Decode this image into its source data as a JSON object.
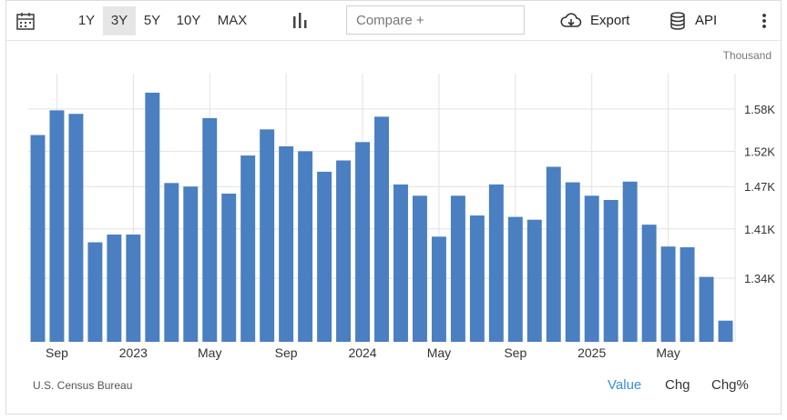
{
  "toolbar": {
    "ranges": [
      {
        "label": "1Y",
        "active": false
      },
      {
        "label": "3Y",
        "active": true
      },
      {
        "label": "5Y",
        "active": false
      },
      {
        "label": "10Y",
        "active": false
      },
      {
        "label": "MAX",
        "active": false
      }
    ],
    "compare_placeholder": "Compare +",
    "export_label": "Export",
    "api_label": "API"
  },
  "unit_label": "Thousand",
  "source": "U.S. Census Bureau",
  "views": [
    {
      "label": "Value",
      "active": true
    },
    {
      "label": "Chg",
      "active": false
    },
    {
      "label": "Chg%",
      "active": false
    }
  ],
  "colors": {
    "bar": "#4a7fc1",
    "active_tab": "#3a8fd9",
    "grid": "#e2e2e2"
  },
  "chart_data": {
    "type": "bar",
    "title": "",
    "xlabel": "",
    "ylabel": "",
    "x": [
      "2022-08",
      "2022-09",
      "2022-10",
      "2022-11",
      "2022-12",
      "2023-01",
      "2023-02",
      "2023-03",
      "2023-04",
      "2023-05",
      "2023-06",
      "2023-07",
      "2023-08",
      "2023-09",
      "2023-10",
      "2023-11",
      "2023-12",
      "2024-01",
      "2024-02",
      "2024-03",
      "2024-04",
      "2024-05",
      "2024-06",
      "2024-07",
      "2024-08",
      "2024-09",
      "2024-10",
      "2024-11",
      "2024-12",
      "2025-01",
      "2025-02",
      "2025-03",
      "2025-04",
      "2025-05",
      "2025-06",
      "2025-07"
    ],
    "values": [
      1.543,
      1.578,
      1.573,
      1.391,
      1.402,
      1.402,
      1.603,
      1.475,
      1.47,
      1.567,
      1.46,
      1.514,
      1.551,
      1.527,
      1.52,
      1.491,
      1.507,
      1.533,
      1.569,
      1.473,
      1.457,
      1.399,
      1.457,
      1.429,
      1.473,
      1.427,
      1.423,
      1.498,
      1.476,
      1.457,
      1.451,
      1.477,
      1.416,
      1.385,
      1.384,
      1.342,
      1.28
    ],
    "value_unit": "Thousand",
    "y_ticks": [
      "1.34K",
      "1.41K",
      "1.47K",
      "1.52K",
      "1.58K"
    ],
    "y_tick_values": [
      1.34,
      1.41,
      1.47,
      1.52,
      1.58
    ],
    "ylim": [
      1.25,
      1.63
    ],
    "x_tick_labels": [
      {
        "label": "Sep",
        "index": 1
      },
      {
        "label": "2023",
        "index": 5
      },
      {
        "label": "May",
        "index": 9
      },
      {
        "label": "Sep",
        "index": 13
      },
      {
        "label": "2024",
        "index": 17
      },
      {
        "label": "May",
        "index": 21
      },
      {
        "label": "Sep",
        "index": 25
      },
      {
        "label": "2025",
        "index": 29
      },
      {
        "label": "May",
        "index": 33
      }
    ],
    "grid": true,
    "y_axis_side": "right"
  }
}
